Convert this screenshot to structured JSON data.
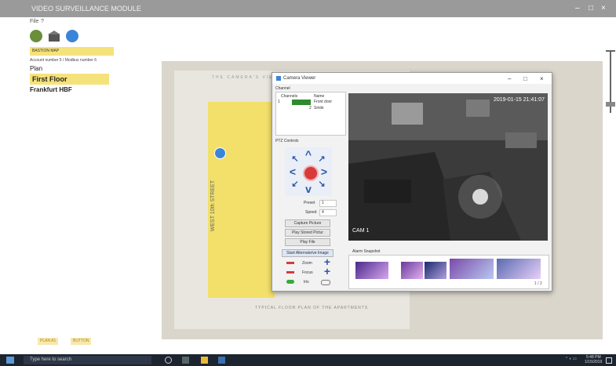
{
  "app": {
    "title": "VIDEO SURVEILLANCE MODULE",
    "menu": [
      "File",
      "?"
    ],
    "window_controls": [
      "–",
      "□",
      "×"
    ]
  },
  "toolbar": {
    "icons": [
      "globe-icon",
      "building-icon",
      "network-icon"
    ]
  },
  "sidebar": {
    "box_label": "BASTION MAP",
    "account_text": "Account number 5 / Modbus number 6",
    "plan_label": "Plan",
    "floor_label": "First Floor",
    "site_label": "Frankfurt HBF"
  },
  "floorplan": {
    "top_label": "THE CAMERA'S VIEW",
    "street_label": "WEST 10th STREET",
    "bottom_label": "TYPICAL FLOOR PLAN OF THE APARTMENTS"
  },
  "bottom_left_buttons": [
    "PLAN A1",
    "BUTTON"
  ],
  "camera_window": {
    "title": "Camera Viewer",
    "channel_header": "Channel",
    "columns": [
      "Channels",
      "Name"
    ],
    "rows": [
      {
        "index": "1",
        "name": "Front door",
        "selected": true
      },
      {
        "index": "2",
        "name": "Smile",
        "selected": false
      }
    ],
    "ptz_label": "PTZ Controls",
    "preset_label": "Preset",
    "preset_value": "1",
    "speed_label": "Speed",
    "speed_value": "4",
    "buttons": [
      "Capture Picture",
      "Play Stored Pictur",
      "Play File",
      "Start Alternate/ve Image"
    ],
    "zoom_label": "Zoom",
    "focus_label": "Focus",
    "iris_label": "Iris",
    "video_timestamp": "2019-01-15 21:41:07",
    "video_camera_label": "CAM 1",
    "thumbs_label": "Alarm Snapshot",
    "page_indicator": "1 / 2"
  },
  "taskbar": {
    "search_placeholder": "Type here to search",
    "time": "5:48 PM",
    "date": "1/15/2019"
  },
  "colors": {
    "accent": "#2c59a8",
    "highlight": "#f6e27a",
    "record": "#d83a3a",
    "channel_selected": "#2e8b2e"
  }
}
